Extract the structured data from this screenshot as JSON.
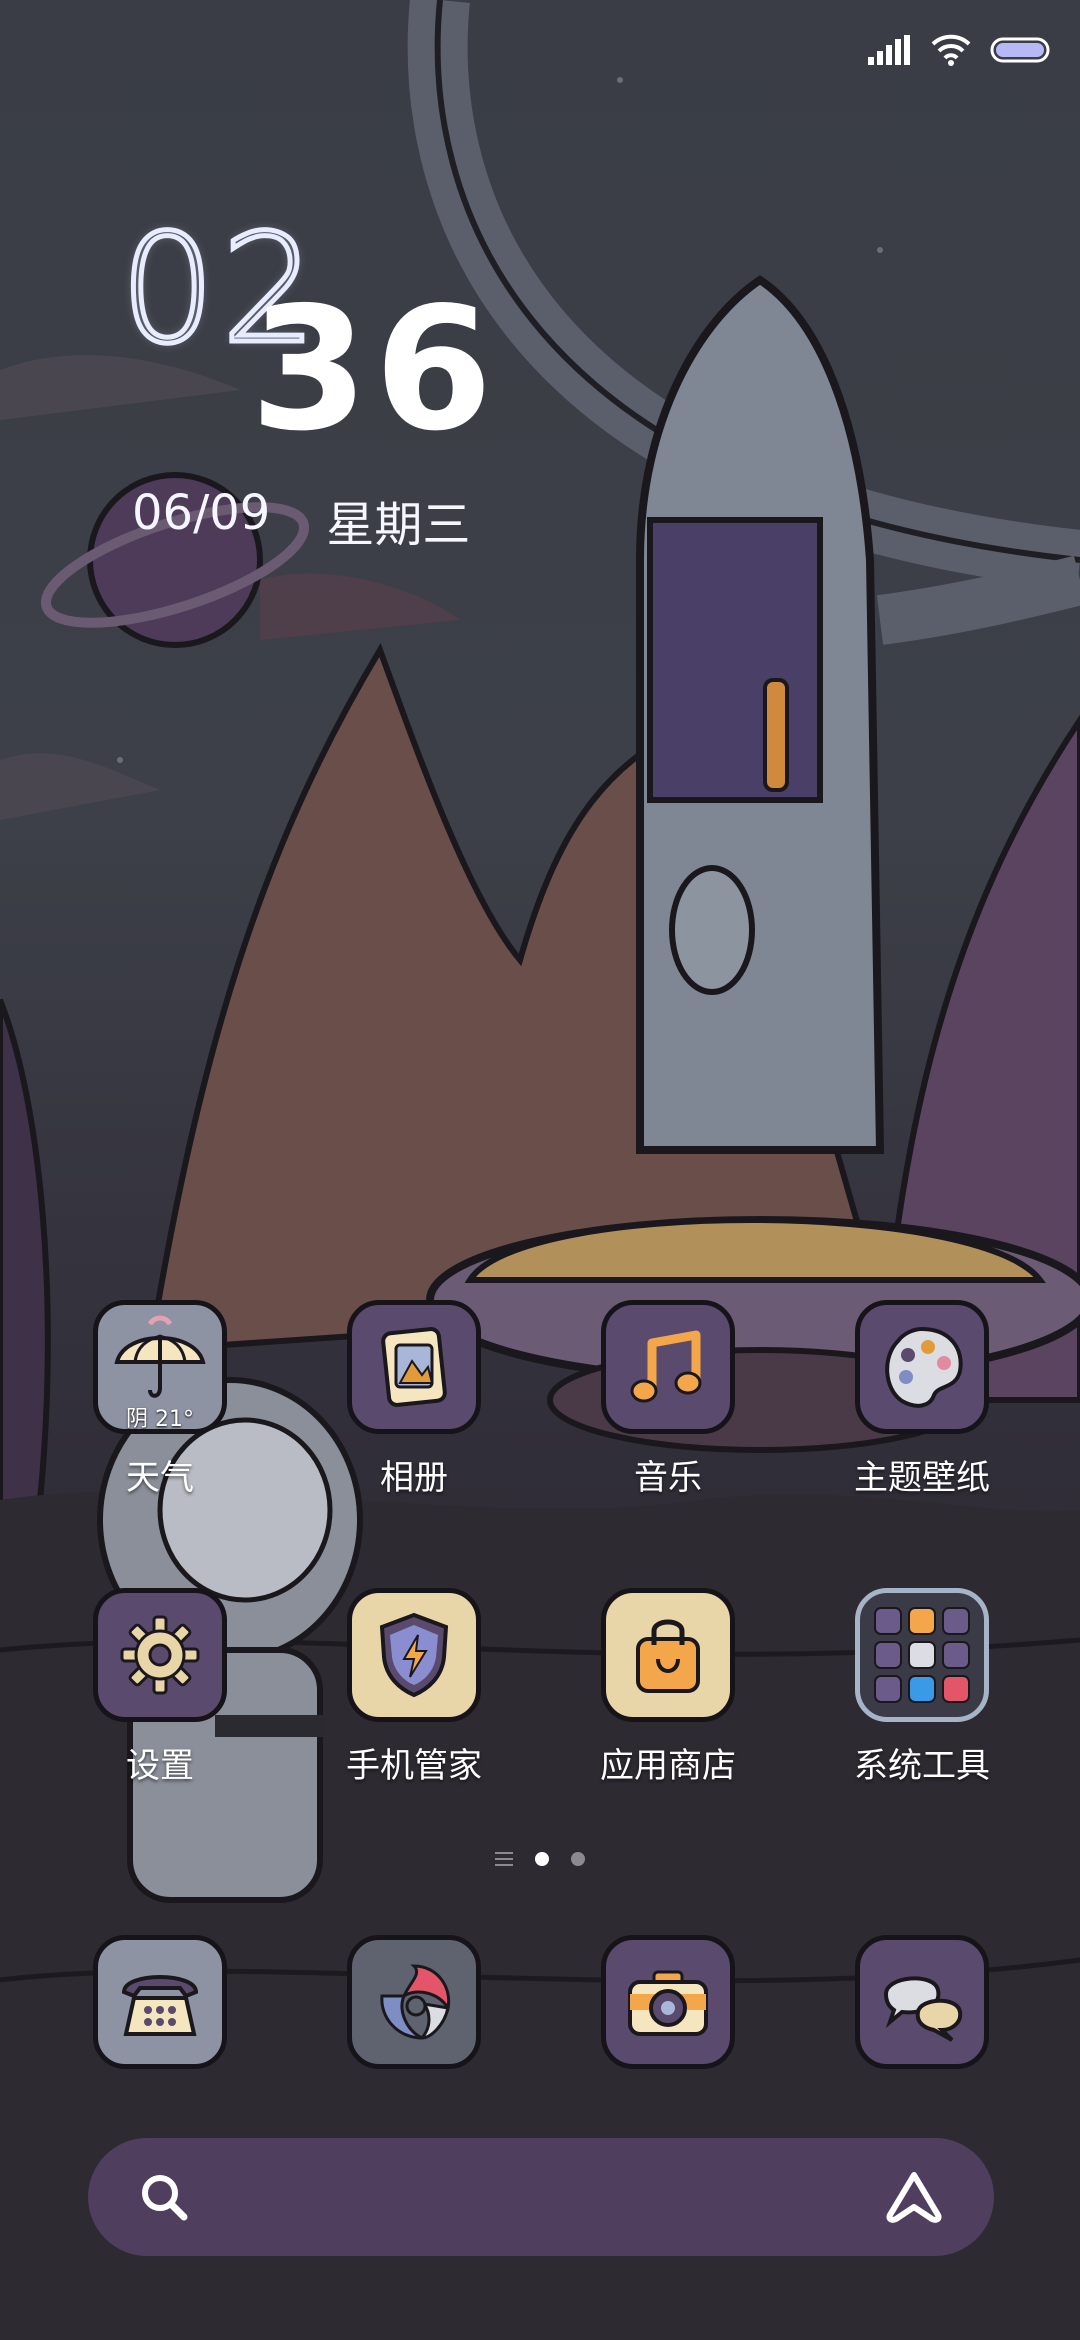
{
  "status_bar": {
    "icons": [
      "signal-icon",
      "wifi-icon",
      "battery-icon"
    ]
  },
  "clock": {
    "hour": "02",
    "minute": "36",
    "date": "06/09",
    "weekday": "星期三"
  },
  "weather_widget": {
    "text": "阴 21°"
  },
  "apps_row1": [
    {
      "label": "天气",
      "icon": "weather-umbrella-icon"
    },
    {
      "label": "相册",
      "icon": "gallery-icon"
    },
    {
      "label": "音乐",
      "icon": "music-note-icon"
    },
    {
      "label": "主题壁纸",
      "icon": "palette-icon"
    }
  ],
  "apps_row2": [
    {
      "label": "设置",
      "icon": "gear-icon"
    },
    {
      "label": "手机管家",
      "icon": "security-shield-icon"
    },
    {
      "label": "应用商店",
      "icon": "shopping-bag-icon"
    },
    {
      "label": "系统工具",
      "icon": "folder-icon"
    }
  ],
  "page_indicator": {
    "pages": 2,
    "current": 1
  },
  "dock": [
    {
      "icon": "phone-icon"
    },
    {
      "icon": "browser-icon"
    },
    {
      "icon": "camera-icon"
    },
    {
      "icon": "messages-icon"
    }
  ],
  "search_bar": {
    "left_icon": "search-icon",
    "right_icon": "assistant-a-icon"
  },
  "colors": {
    "icon_purple": "#5a4a6e",
    "icon_cream": "#e9d6a8",
    "icon_slate": "#8d93a3",
    "search_bg": "#4f3e5e"
  }
}
